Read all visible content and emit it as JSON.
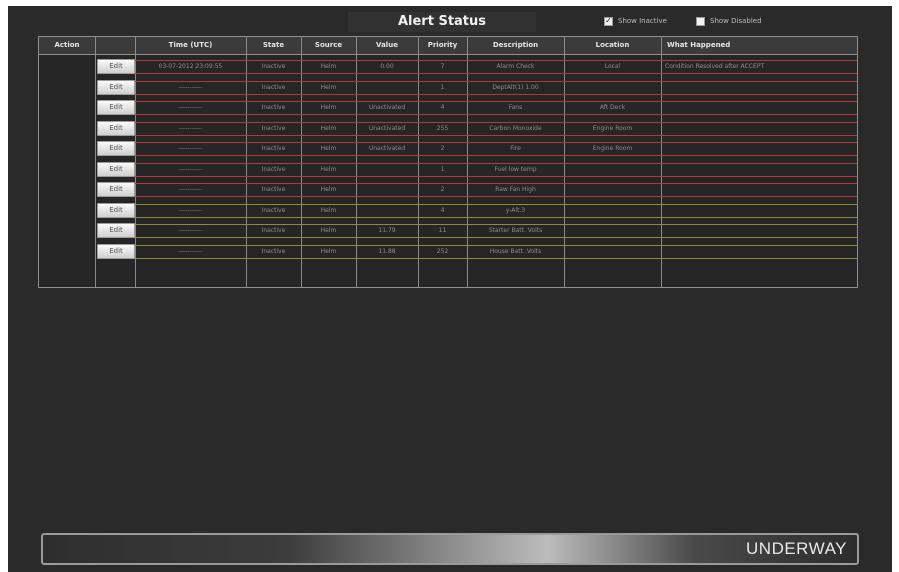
{
  "title": "Alert Status",
  "toggles": {
    "show_inactive": {
      "label": "Show Inactive",
      "checked": true
    },
    "show_disabled": {
      "label": "Show Disabled",
      "checked": false
    }
  },
  "table": {
    "columns": [
      "Action",
      "",
      "Time (UTC)",
      "State",
      "Source",
      "Value",
      "Priority",
      "Description",
      "Location",
      "What Happened"
    ],
    "edit_label": "Edit",
    "rows": [
      {
        "time": "03-07-2012 23:09:55",
        "state": "Inactive",
        "source": "Helm",
        "value": "0.00",
        "priority": "7",
        "description": "Alarm Check",
        "location": "Local",
        "what": "Condition Resolved after ACCEPT",
        "band": "#b23a3a"
      },
      {
        "time": "-----------",
        "state": "Inactive",
        "source": "Helm",
        "value": "",
        "priority": "1",
        "description": "DeptAlt(1) 1.00",
        "location": "",
        "what": "",
        "band": "#b23a3a"
      },
      {
        "time": "-----------",
        "state": "Inactive",
        "source": "Helm",
        "value": "Unactivated",
        "priority": "4",
        "description": "Fans",
        "location": "Aft Deck",
        "what": "",
        "band": "#b23a3a"
      },
      {
        "time": "-----------",
        "state": "Inactive",
        "source": "Helm",
        "value": "Unactivated",
        "priority": "255",
        "description": "Carbon Monoxide",
        "location": "Engine Room",
        "what": "",
        "band": "#b23a3a"
      },
      {
        "time": "-----------",
        "state": "Inactive",
        "source": "Helm",
        "value": "Unactivated",
        "priority": "2",
        "description": "Fire",
        "location": "Engine Room",
        "what": "",
        "band": "#b23a3a"
      },
      {
        "time": "-----------",
        "state": "Inactive",
        "source": "Helm",
        "value": "",
        "priority": "1",
        "description": "Fuel low temp",
        "location": "",
        "what": "",
        "band": "#b23a3a"
      },
      {
        "time": "-----------",
        "state": "Inactive",
        "source": "Helm",
        "value": "",
        "priority": "2",
        "description": "Raw Fan High",
        "location": "",
        "what": "",
        "band": "#b23a3a"
      },
      {
        "time": "-----------",
        "state": "Inactive",
        "source": "Helm",
        "value": "",
        "priority": "4",
        "description": "y-Alt.3",
        "location": "",
        "what": "",
        "band": "#8f8a3a"
      },
      {
        "time": "-----------",
        "state": "Inactive",
        "source": "Helm",
        "value": "11.79",
        "priority": "11",
        "description": "Starter Batt. Volts",
        "location": "",
        "what": "",
        "band": "#8f8a3a"
      },
      {
        "time": "-----------",
        "state": "Inactive",
        "source": "Helm",
        "value": "11.88",
        "priority": "252",
        "description": "House Batt. Volts",
        "location": "",
        "what": "",
        "band": "#8f8a3a"
      }
    ]
  },
  "status_bar": {
    "text": "UNDERWAY"
  }
}
